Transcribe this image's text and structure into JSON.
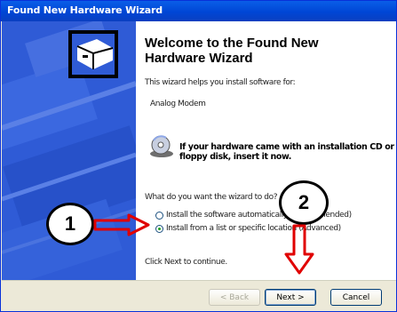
{
  "window": {
    "title": "Found New Hardware Wizard"
  },
  "content": {
    "heading": "Welcome to the Found New Hardware Wizard",
    "intro": "This wizard helps you install software for:",
    "device_name": "Analog Modem",
    "cd_notice": "If your hardware came with an installation CD or floppy disk, insert it now.",
    "question": "What do you want the wizard to do?",
    "options": [
      {
        "label": "Install the software automatically (Recommended)",
        "selected": false
      },
      {
        "label": "Install from a list or specific location (Advanced)",
        "selected": true
      }
    ],
    "footer_hint": "Click Next to continue."
  },
  "buttons": {
    "back": "< Back",
    "next": "Next >",
    "cancel": "Cancel"
  },
  "callouts": [
    {
      "number": "1"
    },
    {
      "number": "2"
    }
  ],
  "colors": {
    "title_bar": "#0054e3",
    "sidebar": "#2f5bd6",
    "annotation_arrow": "#e00000"
  }
}
